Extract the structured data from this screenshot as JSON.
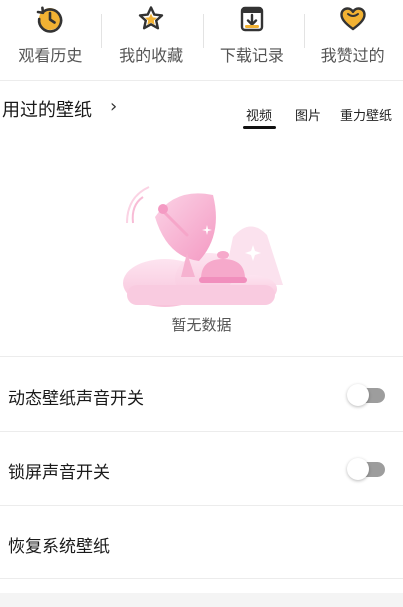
{
  "quick_actions": [
    {
      "label": "观看历史",
      "icon": "history-icon"
    },
    {
      "label": "我的收藏",
      "icon": "star-icon"
    },
    {
      "label": "下载记录",
      "icon": "download-box-icon"
    },
    {
      "label": "我赞过的",
      "icon": "heart-icon"
    }
  ],
  "used_section": {
    "title": "用过的壁纸",
    "chevron": "›",
    "tabs": [
      {
        "label": "视频",
        "selected": true
      },
      {
        "label": "图片",
        "selected": false
      },
      {
        "label": "重力壁纸",
        "selected": false
      }
    ],
    "empty_text": "暂无数据"
  },
  "settings": {
    "dynamic_sound_label": "动态壁纸声音开关",
    "dynamic_sound_on": false,
    "lock_sound_label": "锁屏声音开关",
    "lock_sound_on": false,
    "restore_label": "恢复系统壁纸"
  },
  "colors": {
    "icon_dark": "#333333",
    "icon_accent": "#f2b233",
    "illustration_pink": "#f7a8cc",
    "toggle_off": "#9d9d9d"
  }
}
